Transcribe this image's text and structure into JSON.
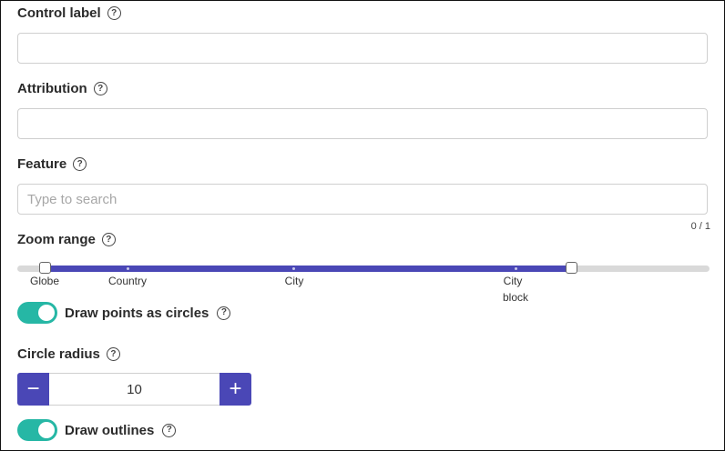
{
  "fields": {
    "control_label": {
      "label": "Control label",
      "value": ""
    },
    "attribution": {
      "label": "Attribution",
      "value": ""
    },
    "feature": {
      "label": "Feature",
      "placeholder": "Type to search",
      "counter": "0 / 1"
    }
  },
  "zoom_range": {
    "label": "Zoom range",
    "min_label": "Globe",
    "max_label": "City block",
    "tick_labels": [
      "Globe",
      "Country",
      "City",
      "City",
      "block"
    ],
    "selected_start_fraction": 0.04,
    "selected_end_fraction": 0.8
  },
  "draw_points": {
    "label": "Draw points as circles",
    "on": true
  },
  "circle_radius": {
    "label": "Circle radius",
    "value": "10",
    "minus": "−",
    "plus": "+"
  },
  "draw_outlines": {
    "label": "Draw outlines",
    "on": true
  },
  "colors": {
    "accent": "#4a47b6",
    "toggle": "#26b7a5"
  },
  "icons": {
    "help": "help-circle-icon"
  }
}
